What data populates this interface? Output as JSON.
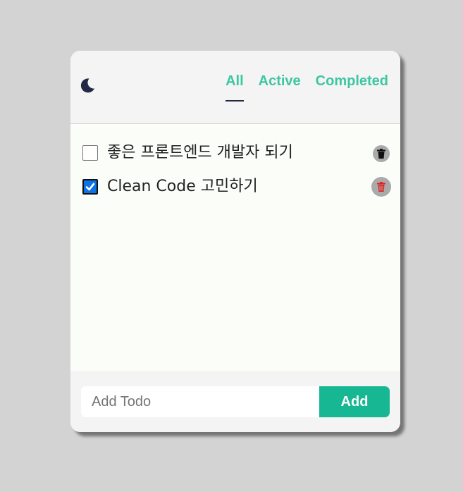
{
  "header": {
    "theme_icon": "moon-icon",
    "tabs": [
      {
        "label": "All",
        "active": true
      },
      {
        "label": "Active",
        "active": false
      },
      {
        "label": "Completed",
        "active": false
      }
    ]
  },
  "todos": [
    {
      "text": "좋은 프론트엔드 개발자 되기",
      "completed": false,
      "delete_icon": "trash-icon"
    },
    {
      "text": "Clean Code 고민하기",
      "completed": true,
      "delete_icon": "trash-icon"
    }
  ],
  "footer": {
    "input_placeholder": "Add Todo",
    "input_value": "",
    "add_label": "Add"
  },
  "colors": {
    "accent": "#3ec6a2",
    "add_button": "#17b794",
    "tab_underline": "#232845",
    "checkbox_checked": "#0b72e7",
    "trash_active": "#e0231f"
  }
}
